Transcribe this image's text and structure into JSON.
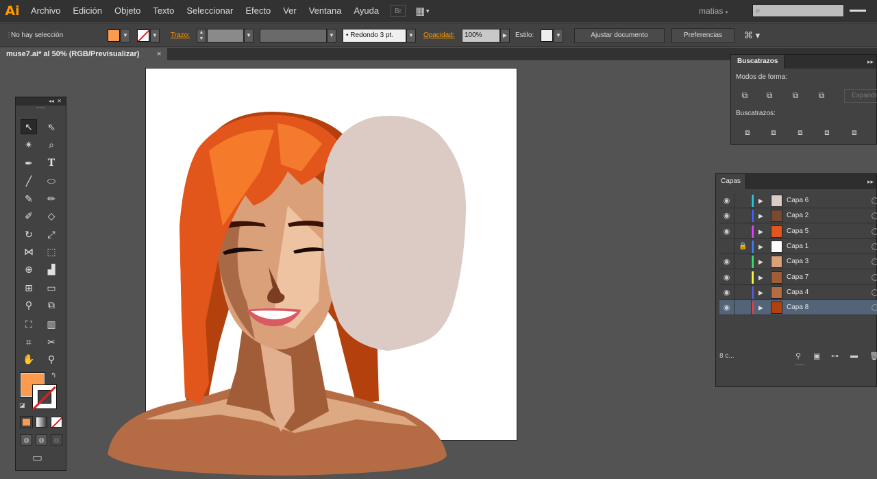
{
  "app": {
    "logo": "Ai",
    "user": "matias"
  },
  "menu": [
    "Archivo",
    "Edición",
    "Objeto",
    "Texto",
    "Seleccionar",
    "Efecto",
    "Ver",
    "Ventana",
    "Ayuda"
  ],
  "control": {
    "selection": "No hay selección",
    "stroke_label": "Trazo:",
    "brush": "• Redondo 3 pt.",
    "opacity_label": "Opacidad:",
    "opacity_value": "100%",
    "style_label": "Estilo:",
    "fit_button": "Ajustar documento",
    "prefs_button": "Preferencias"
  },
  "document": {
    "tab": "muse7.ai* al 50% (RGB/Previsualizar)",
    "close": "×"
  },
  "colors": {
    "fill": "#fb9b4f",
    "accent": "#ff9a00",
    "layer_selected": "#546478"
  },
  "pathfinder": {
    "title": "Buscatrazos",
    "shape_modes": "Modos de forma:",
    "pathfinders": "Buscatrazos:",
    "expand": "Expandir"
  },
  "layers": {
    "title": "Capas",
    "count": "8 c...",
    "items": [
      {
        "name": "Capa 6",
        "color": "#26c6da",
        "visible": true,
        "locked": false
      },
      {
        "name": "Capa 2",
        "color": "#3f63f5",
        "visible": true,
        "locked": false
      },
      {
        "name": "Capa 5",
        "color": "#e040fb",
        "visible": true,
        "locked": false
      },
      {
        "name": "Capa 1",
        "color": "#3f7bf5",
        "visible": false,
        "locked": true
      },
      {
        "name": "Capa 3",
        "color": "#3ddc6a",
        "visible": true,
        "locked": false
      },
      {
        "name": "Capa 7",
        "color": "#f5f53f",
        "visible": true,
        "locked": false
      },
      {
        "name": "Capa 4",
        "color": "#5b5bd6",
        "visible": true,
        "locked": false
      },
      {
        "name": "Capa 8",
        "color": "#e04040",
        "visible": true,
        "locked": false,
        "selected": true
      }
    ]
  }
}
